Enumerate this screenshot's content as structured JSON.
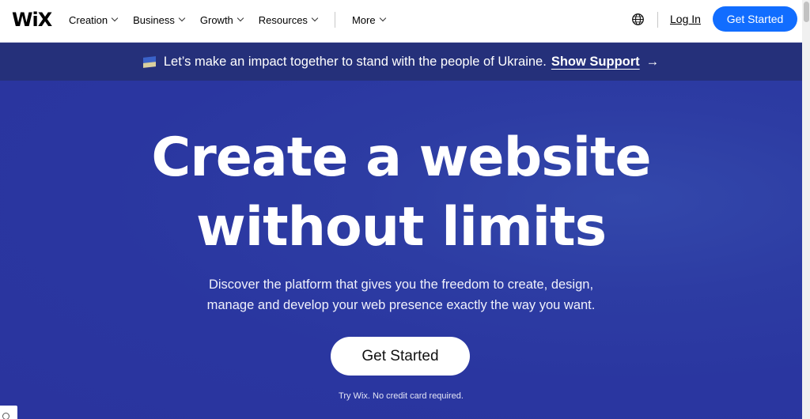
{
  "header": {
    "logo": "WiX",
    "nav": [
      {
        "label": "Creation"
      },
      {
        "label": "Business"
      },
      {
        "label": "Growth"
      },
      {
        "label": "Resources"
      }
    ],
    "more_label": "More",
    "globe_icon": "globe-icon",
    "login_label": "Log In",
    "get_started_label": "Get Started"
  },
  "banner": {
    "flag_icon": "ukraine-flag-icon",
    "text": "Let’s make an impact together to stand with the people of Ukraine.",
    "link_label": "Show Support",
    "arrow": "→"
  },
  "hero": {
    "headline_line1": "Create a website",
    "headline_line2": "without limits",
    "subtitle_line1": "Discover the platform that gives you the freedom to create, design,",
    "subtitle_line2": "manage and develop your web presence exactly the way you want.",
    "cta_label": "Get Started",
    "note": "Try Wix. No credit card required."
  },
  "colors": {
    "primary_blue": "#116dff",
    "banner_bg": "#25307a",
    "hero_bg": "#2a36a0"
  }
}
